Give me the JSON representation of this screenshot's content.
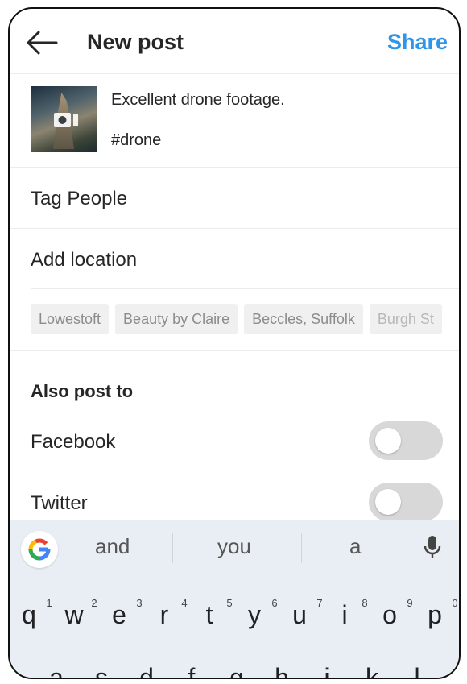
{
  "header": {
    "title": "New post",
    "share_label": "Share"
  },
  "post": {
    "caption": "Excellent drone footage.",
    "hashtag": "#drone"
  },
  "rows": {
    "tag_people": "Tag People",
    "add_location": "Add location"
  },
  "location_chips": [
    "Lowestoft",
    "Beauty by Claire",
    "Beccles, Suffolk",
    "Burgh St"
  ],
  "also_post": {
    "heading": "Also post to",
    "facebook_label": "Facebook",
    "facebook_on": false,
    "twitter_label": "Twitter",
    "twitter_on": false
  },
  "keyboard": {
    "suggestions": [
      "and",
      "you",
      "a"
    ],
    "row1": [
      "q",
      "w",
      "e",
      "r",
      "t",
      "y",
      "u",
      "i",
      "o",
      "p"
    ],
    "row1_numbers": [
      "1",
      "2",
      "3",
      "4",
      "5",
      "6",
      "7",
      "8",
      "9",
      "0"
    ],
    "row2": [
      "a",
      "s",
      "d",
      "f",
      "g",
      "h",
      "j",
      "k",
      "l"
    ]
  },
  "colors": {
    "accent": "#2f95e8",
    "toggle_off": "#d8d8d8",
    "keyboard_bg": "#e8eef4"
  }
}
